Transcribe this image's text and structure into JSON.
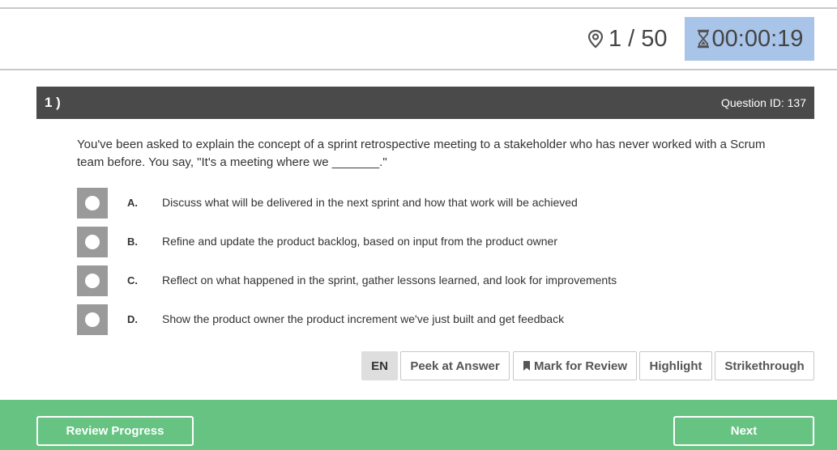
{
  "header": {
    "progress": "1 / 50",
    "timer": "00:00:19",
    "timer_bg": "#a9c4e9"
  },
  "question": {
    "number": "1 )",
    "id_label": "Question ID: 137",
    "text": "You've been asked to explain the concept of a sprint retrospective meeting to a stakeholder who has never worked with a Scrum team before. You say, \"It's a meeting where we _______.\""
  },
  "options": [
    {
      "letter": "A.",
      "text": "Discuss what will be delivered in the next sprint and how that work will be achieved"
    },
    {
      "letter": "B.",
      "text": "Refine and update the product backlog, based on input from the product owner"
    },
    {
      "letter": "C.",
      "text": "Reflect on what happened in the sprint, gather lessons learned, and look for improvements"
    },
    {
      "letter": "D.",
      "text": "Show the product owner the product increment we've just built and get feedback"
    }
  ],
  "tools": {
    "language": "EN",
    "peek": "Peek at Answer",
    "mark": "Mark for Review",
    "highlight": "Highlight",
    "strikethrough": "Strikethrough"
  },
  "footer": {
    "review": "Review Progress",
    "next": "Next",
    "color": "#66c382"
  },
  "icons": {
    "progress": "map-pin-icon",
    "timer": "hourglass-icon",
    "mark": "bookmark-icon"
  }
}
